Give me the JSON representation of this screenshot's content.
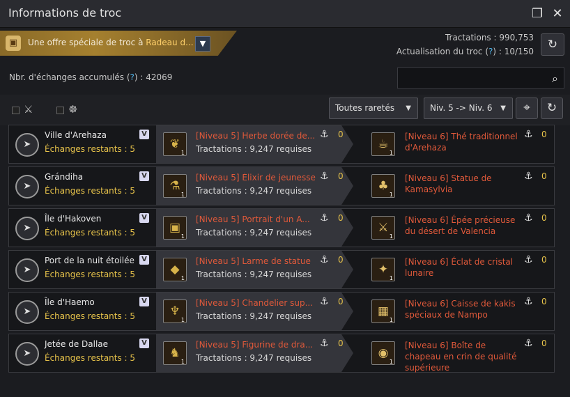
{
  "window": {
    "title": "Informations de troc"
  },
  "banner": {
    "text": "Une offre spéciale de troc à ",
    "highlight": "Radeau d..."
  },
  "stats": {
    "tractations_label": "Tractations :",
    "tractations_value": "990,753",
    "refresh_label": "Actualisation du troc (",
    "refresh_q": "?",
    "refresh_close": ") :",
    "refresh_value": "10/150"
  },
  "accumulated": {
    "label": "Nbr. d'échanges accumulés (",
    "q": "?",
    "close": ") :",
    "value": "42069"
  },
  "search": {
    "placeholder": ""
  },
  "filters": {
    "rarity": "Toutes raretés",
    "level": "Niv. 5 -> Niv. 6"
  },
  "rows": [
    {
      "city": "Ville d'Arehaza",
      "remaining": "Échanges restants : 5",
      "give_name": "[Niveau 5] Herbe dorée de...",
      "give_req": "Tractations : 9,247 requises",
      "give_anchor": "0",
      "get_name": "[Niveau 6] Thé traditionnel d'Arehaza",
      "get_anchor": "0",
      "give_icon": "herb-icon",
      "get_icon": "tea-icon"
    },
    {
      "city": "Grándiha",
      "remaining": "Échanges restants : 5",
      "give_name": "[Niveau 5] Élixir de jeunesse",
      "give_req": "Tractations : 9,247 requises",
      "give_anchor": "0",
      "get_name": "[Niveau 6] Statue de Kamasylvia",
      "get_anchor": "0",
      "give_icon": "elixir-icon",
      "get_icon": "statue-icon"
    },
    {
      "city": "Île d'Hakoven",
      "remaining": "Échanges restants : 5",
      "give_name": "[Niveau 5] Portrait d'un A...",
      "give_req": "Tractations : 9,247 requises",
      "give_anchor": "0",
      "get_name": "[Niveau 6] Épée précieuse du désert de Valencia",
      "get_anchor": "0",
      "give_icon": "portrait-icon",
      "get_icon": "sword-icon"
    },
    {
      "city": "Port de la nuit étoilée",
      "remaining": "Échanges restants : 5",
      "give_name": "[Niveau 5] Larme de statue",
      "give_req": "Tractations : 9,247 requises",
      "give_anchor": "0",
      "get_name": "[Niveau 6] Éclat de cristal lunaire",
      "get_anchor": "0",
      "give_icon": "tear-icon",
      "get_icon": "crystal-icon"
    },
    {
      "city": "Île d'Haemo",
      "remaining": "Échanges restants : 5",
      "give_name": "[Niveau 5] Chandelier sup...",
      "give_req": "Tractations : 9,247 requises",
      "give_anchor": "0",
      "get_name": "[Niveau 6] Caisse de kakis spéciaux de Nampo",
      "get_anchor": "0",
      "give_icon": "candlestick-icon",
      "get_icon": "crate-icon"
    },
    {
      "city": "Jetée de Dallae",
      "remaining": "Échanges restants : 5",
      "give_name": "[Niveau 5] Figurine de dra...",
      "give_req": "Tractations : 9,247 requises",
      "give_anchor": "0",
      "get_name": "[Niveau 6] Boîte de chapeau en crin de qualité supérieure",
      "get_anchor": "0",
      "give_icon": "dragon-figurine-icon",
      "get_icon": "hatbox-icon"
    }
  ]
}
